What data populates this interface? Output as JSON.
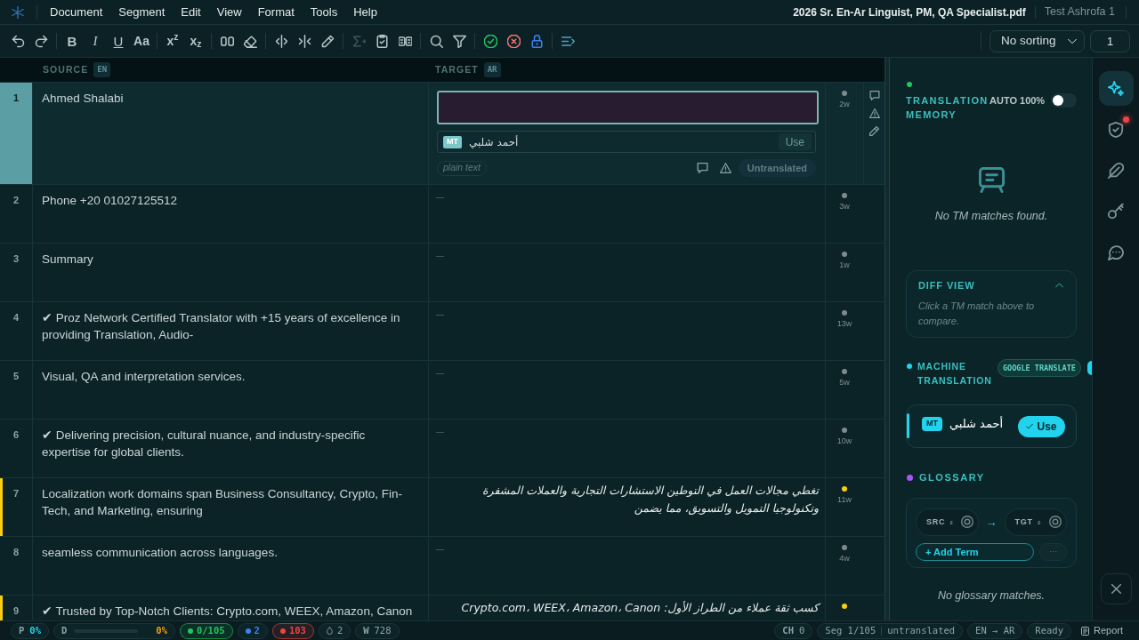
{
  "menu": {
    "items": [
      "Document",
      "Segment",
      "Edit",
      "View",
      "Format",
      "Tools",
      "Help"
    ],
    "file_name": "2026 Sr. En-Ar Linguist, PM, QA Specialist.pdf",
    "user": "Test Ashrofa 1"
  },
  "toolbar": {
    "groups": [
      [
        {
          "kind": "icon",
          "disabled": false
        },
        {
          "kind": "icon",
          "disabled": false
        }
      ],
      [
        {
          "kind": "bold",
          "label": "B",
          "disabled": false
        },
        {
          "kind": "italic",
          "label": "I",
          "disabled": false
        },
        {
          "kind": "underline",
          "label": "U",
          "disabled": false
        },
        {
          "kind": "case",
          "label": "Aa",
          "disabled": false
        }
      ],
      [
        {
          "kind": "superscript",
          "label": "x$^{z}$",
          "disabled": false
        },
        {
          "kind": "subscript",
          "label": "x$_{z}$",
          "disabled": false
        }
      ],
      [
        {
          "kind": "icon",
          "disabled": false
        },
        {
          "kind": "icon",
          "disabled": false
        }
      ],
      [
        {
          "kind": "icon",
          "disabled": false
        },
        {
          "kind": "icon",
          "disabled": false
        },
        {
          "kind": "icon",
          "disabled": false
        }
      ],
      [
        {
          "kind": "icon",
          "disabled": true
        },
        {
          "kind": "icon",
          "disabled": false
        },
        {
          "kind": "icon",
          "disabled": false
        }
      ],
      [
        {
          "kind": "icon",
          "disabled": false
        },
        {
          "kind": "icon",
          "disabled": false
        }
      ],
      [
        {
          "kind": "icon",
          "disabled": false
        },
        {
          "kind": "icon",
          "disabled": false
        },
        {
          "kind": "icon",
          "disabled": false
        }
      ],
      [
        {
          "kind": "icon",
          "disabled": false
        }
      ]
    ],
    "sort": {
      "value": "No sorting"
    },
    "page": "1"
  },
  "columns": [
    {
      "label": "SOURCE",
      "lang": "EN"
    },
    {
      "label": "TARGET",
      "lang": "AR"
    }
  ],
  "rows": [
    {
      "number": "1",
      "source": "Ahmed Shalabi",
      "words": "2w",
      "color": "#7d8b8e",
      "selected": true
    },
    {
      "number": "2",
      "source": "Phone +20 01027125512",
      "words": "3w",
      "color": "#7d8b8e",
      "selected": false
    },
    {
      "number": "3",
      "source": "Summary",
      "words": "1w",
      "color": "#7d8b8e",
      "selected": false
    },
    {
      "number": "4",
      "source": "✔ Proz Network Certified Translator with +15 years of excellence in providing Translation, Audio-",
      "words": "13w",
      "color": "#7d8b8e",
      "selected": false
    },
    {
      "number": "5",
      "source": "Visual, QA and interpretation services.",
      "words": "5w",
      "color": "#7d8b8e",
      "selected": false
    },
    {
      "number": "6",
      "source": "✔ Delivering precision, cultural nuance, and industry-specific expertise for global clients.",
      "words": "10w",
      "color": "#7d8b8e",
      "selected": false
    },
    {
      "number": "7",
      "source": "Localization work domains span Business Consultancy, Crypto, Fin-Tech, and Marketing, ensuring",
      "target": "تغطي مجالات العمل في التوطين الاستشارات التجارية والعملات المشفرة وتكنولوجيا التمويل والتسويق، مما يضمن",
      "words": "11w",
      "color": "#facc15",
      "selected": false
    },
    {
      "number": "8",
      "source": "seamless communication across languages.",
      "words": "4w",
      "color": "#7d8b8e",
      "selected": false
    },
    {
      "number": "9",
      "source": "✔ Trusted by Top-Notch Clients: Crypto.com, WEEX, Amazon, Canon",
      "target": "كسب ثقة عملاء من الطراز الأول: Crypto.com، WEEX، Amazon، Canon",
      "color": "#facc15",
      "selected": false
    }
  ],
  "editor": {
    "suggestion": {
      "badge": "MT",
      "text": "أحمد شلبي",
      "button": "Use"
    },
    "format": "plain text",
    "status": "Untranslated"
  },
  "translation_memory": {
    "title": "TRANSLATION MEMORY",
    "auto_label": "AUTO 100%",
    "auto_on": false,
    "empty_text": "No TM matches found."
  },
  "diff_view": {
    "title": "DIFF VIEW",
    "expanded": true,
    "hint": "Click a TM match above to compare."
  },
  "machine_translation": {
    "title": "MACHINE TRANSLATION",
    "provider": "GOOGLE TRANSLATE",
    "suggestion": {
      "badge": "MT",
      "text": "أحمد شلبي",
      "button": "Use"
    }
  },
  "glossary": {
    "title": "GLOSSARY",
    "source_field": {
      "label": "SRC",
      "value": "ء"
    },
    "target_field": {
      "label": "TGT",
      "value": "ء"
    },
    "arrow": "→",
    "add_button": "+ Add Term",
    "more_button": "···",
    "empty_text": "No glossary matches."
  },
  "rail": [
    {
      "selected": true,
      "alert": false
    },
    {
      "selected": false,
      "alert": true
    },
    {
      "selected": false,
      "alert": false
    },
    {
      "selected": false,
      "alert": false
    },
    {
      "selected": false,
      "alert": false
    }
  ],
  "status_bar": {
    "left": [
      {
        "kind": "stat",
        "label": "P",
        "value": "0%",
        "color": "#22d3ee",
        "highlighted": false
      },
      {
        "kind": "progress",
        "label": "D",
        "value": "0%",
        "level": 0,
        "color": "#f59e0b",
        "highlighted": false
      },
      {
        "kind": "dot",
        "value": "0/105",
        "color": "#22c55e",
        "highlighted": true
      },
      {
        "kind": "dot",
        "value": "2",
        "color": "#3b82f6",
        "highlighted": false
      },
      {
        "kind": "dot",
        "value": "103",
        "color": "#ef4444",
        "highlighted": true
      },
      {
        "kind": "drop",
        "value": "2",
        "highlighted": false
      },
      {
        "kind": "stat",
        "label": "W",
        "value": "728",
        "highlighted": false
      }
    ],
    "right": [
      {
        "kind": "stat",
        "label": "CH",
        "value": "0"
      },
      {
        "kind": "segment",
        "value": "Seg 1/105",
        "status": "untranslated"
      },
      {
        "kind": "text",
        "value": "EN → AR"
      },
      {
        "kind": "text",
        "value": "Ready"
      },
      {
        "kind": "link",
        "value": "Report"
      }
    ]
  }
}
